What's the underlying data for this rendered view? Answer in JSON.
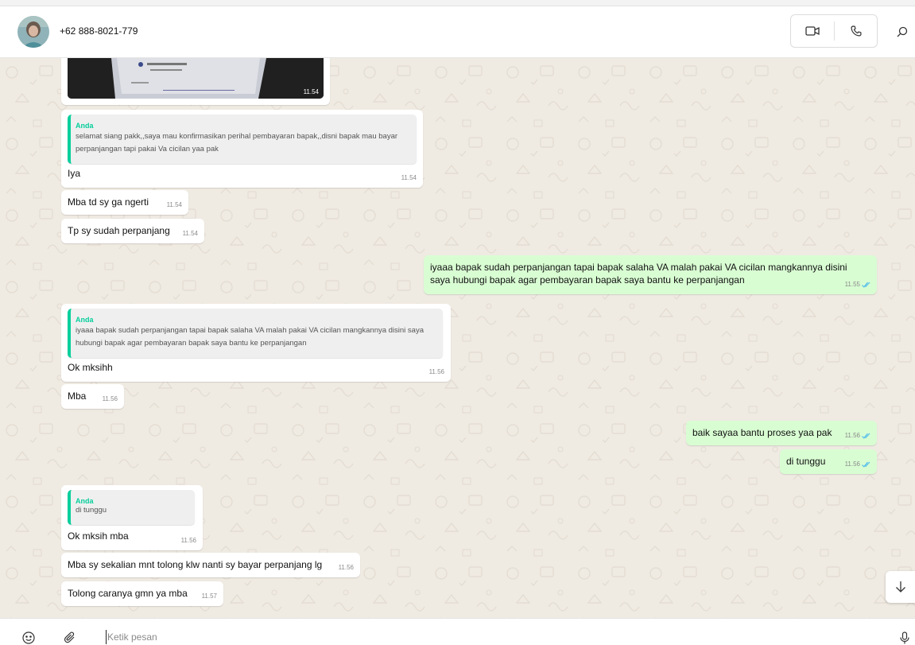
{
  "contact": {
    "name": "+62 888-8021-779",
    "avatar_icon": "contact-avatar"
  },
  "header": {
    "video_call_icon": "video-camera-icon",
    "voice_call_icon": "phone-icon",
    "search_icon": "search-icon"
  },
  "colors": {
    "incoming_bubble": "#ffffff",
    "outgoing_bubble": "#d9fdd3",
    "quote_accent": "#06cf9c",
    "read_ticks": "#53bdeb",
    "chat_background": "#efeae2"
  },
  "photo_message": {
    "time": "11.54"
  },
  "messages": [
    {
      "direction": "in",
      "quote_author": "Anda",
      "quote_text": "selamat siang pakk,,saya mau konfirmasikan perihal pembayaran bapak,,disni bapak mau bayar perpanjangan tapi pakai Va cicilan yaa pak",
      "text": "Iya",
      "time": "11.54"
    },
    {
      "direction": "in",
      "text": "Mba td sy ga ngerti",
      "time": "11.54"
    },
    {
      "direction": "in",
      "text": "Tp sy sudah perpanjang",
      "time": "11.54"
    },
    {
      "direction": "out",
      "text": "iyaaa bapak sudah perpanjangan tapai bapak salaha VA malah pakai VA cicilan mangkannya disini saya hubungi bapak agar pembayaran bapak saya bantu ke perpanjangan",
      "time": "11.55"
    },
    {
      "direction": "in",
      "quote_author": "Anda",
      "quote_text": "iyaaa bapak sudah perpanjangan tapai bapak salaha VA malah pakai VA cicilan mangkannya disini saya hubungi bapak agar pembayaran bapak saya bantu ke perpanjangan",
      "text": "Ok mksihh",
      "time": "11.56"
    },
    {
      "direction": "in",
      "text": "Mba",
      "time": "11.56"
    },
    {
      "direction": "out",
      "text": "baik sayaa bantu proses yaa pak",
      "time": "11.56"
    },
    {
      "direction": "out",
      "text": "di tunggu",
      "time": "11.56"
    },
    {
      "direction": "in",
      "quote_author": "Anda",
      "quote_text": "di tunggu",
      "text": "Ok mksih mba",
      "time": "11.56"
    },
    {
      "direction": "in",
      "text": "Mba sy sekalian mnt tolong klw nanti sy bayar perpanjang lg",
      "time": "11.56"
    },
    {
      "direction": "in",
      "text": "Tolong caranya gmn ya mba",
      "time": "11.57"
    }
  ],
  "scroll_down_icon": "arrow-down-icon",
  "composer": {
    "placeholder": "Ketik pesan",
    "emoji_icon": "emoji-icon",
    "attach_icon": "paperclip-icon",
    "mic_icon": "microphone-icon"
  }
}
